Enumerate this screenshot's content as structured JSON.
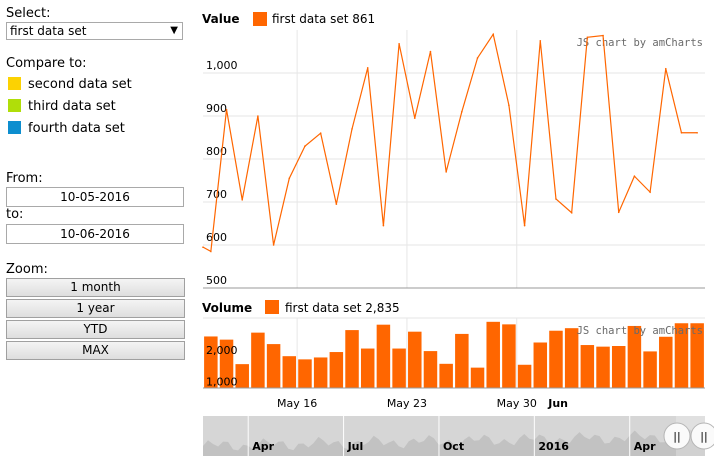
{
  "controls": {
    "select_label": "Select:",
    "selected_set": "first data set",
    "compare_label": "Compare to:",
    "compare_sets": [
      {
        "label": "second data set",
        "color": "#FCD202"
      },
      {
        "label": "third data set",
        "color": "#B0DE09"
      },
      {
        "label": "fourth data set",
        "color": "#0D8ECF"
      }
    ],
    "from_label": "From:",
    "from_value": "10-05-2016",
    "to_label": "to:",
    "to_value": "10-06-2016",
    "zoom_label": "Zoom:",
    "zoom_buttons": [
      "1 month",
      "1 year",
      "YTD",
      "MAX"
    ]
  },
  "colors": {
    "series": "#FF6600",
    "grid": "#e6e6e6",
    "scroll_bg": "#d6d6d6",
    "scroll_fill": "#c2c2c2"
  },
  "chart_data": [
    {
      "type": "line",
      "panel_title": "Value",
      "legend": {
        "name": "first data set",
        "value": "861"
      },
      "credit": "JS chart by amCharts",
      "ylim": [
        500,
        1100
      ],
      "yticks": [
        500,
        600,
        700,
        800,
        900,
        1000
      ],
      "ytick_labels": [
        "500",
        "600",
        "700",
        "800",
        "900",
        "1,000"
      ],
      "x_days": [
        0.0,
        0.5,
        1.5,
        2.5,
        3.5,
        4.5,
        5.5,
        6.5,
        7.5,
        8.5,
        9.5,
        10.5,
        11.5,
        12.5,
        13.5,
        14.5,
        15.5,
        16.5,
        17.5,
        18.5,
        19.5,
        20.5,
        21.5,
        22.5,
        23.5,
        24.5,
        25.5,
        26.5,
        27.5,
        28.5,
        29.5,
        30.5,
        31.5
      ],
      "values": [
        595,
        585,
        915,
        705,
        900,
        600,
        755,
        830,
        860,
        695,
        870,
        1012,
        645,
        1068,
        895,
        1050,
        770,
        910,
        1035,
        1090,
        925,
        645,
        1075,
        707,
        675,
        1083,
        1087,
        676,
        760,
        723,
        1010,
        861,
        861
      ]
    },
    {
      "type": "bar",
      "panel_title": "Volume",
      "legend": {
        "name": "first data set",
        "value": "2,835"
      },
      "credit": "JS chart by amCharts",
      "ylim": [
        800,
        3000
      ],
      "yticks": [
        1000,
        2000
      ],
      "ytick_labels": [
        "1,000",
        "2,000"
      ],
      "x_days": [
        0.5,
        1.5,
        2.5,
        3.5,
        4.5,
        5.5,
        6.5,
        7.5,
        8.5,
        9.5,
        10.5,
        11.5,
        12.5,
        13.5,
        14.5,
        15.5,
        16.5,
        17.5,
        18.5,
        19.5,
        20.5,
        21.5,
        22.5,
        23.5,
        24.5,
        25.5,
        26.5,
        27.5,
        28.5,
        29.5,
        30.5,
        31.5
      ],
      "values": [
        2420,
        2320,
        1550,
        2540,
        2180,
        1800,
        1700,
        1760,
        1930,
        2620,
        2040,
        2790,
        2040,
        2570,
        1960,
        1560,
        2500,
        1440,
        2880,
        2800,
        1530,
        2230,
        2600,
        2680,
        2150,
        2100,
        2120,
        2750,
        1950,
        2410,
        2835,
        2835
      ],
      "xtick_labels": [
        {
          "day": 6,
          "label": "May 16",
          "bold": false
        },
        {
          "day": 13,
          "label": "May 23",
          "bold": false
        },
        {
          "day": 20,
          "label": "May 30",
          "bold": false
        },
        {
          "day": 22,
          "label": "Jun",
          "bold": true
        }
      ]
    }
  ],
  "scrollbar": {
    "labels": [
      {
        "label": "Apr",
        "bold": true,
        "pos": 0.1
      },
      {
        "label": "Jul",
        "bold": true,
        "pos": 0.29
      },
      {
        "label": "Oct",
        "bold": true,
        "pos": 0.48
      },
      {
        "label": "2016",
        "bold": true,
        "pos": 0.67
      },
      {
        "label": "Apr",
        "bold": true,
        "pos": 0.86
      }
    ],
    "grip_label": "||"
  }
}
